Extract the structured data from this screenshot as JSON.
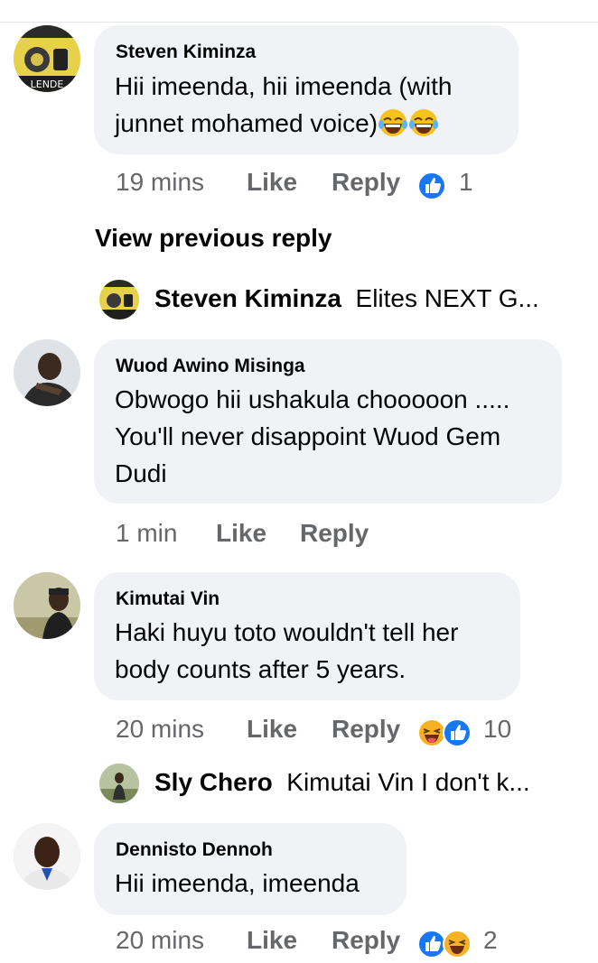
{
  "comments": [
    {
      "author": "Steven Kiminza",
      "text_line1": "Hii imeenda,  hii imeenda (with",
      "text_line2": "junnet mohamed voice)",
      "time": "19 mins",
      "like": "Like",
      "reply": "Reply",
      "reaction_count": "1",
      "avatar_text": "LENDE"
    },
    {
      "author": "Wuod Awino Misinga",
      "text_line1": "Obwogo hii ushakula chooooon .....",
      "text_line2": "You'll never disappoint Wuod Gem",
      "text_line3": "Dudi",
      "time": "1 min",
      "like": "Like",
      "reply": "Reply"
    },
    {
      "author": "Kimutai Vin",
      "text_line1": "Haki huyu toto wouldn't tell her",
      "text_line2": "body counts after 5 years.",
      "time": "20 mins",
      "like": "Like",
      "reply": "Reply",
      "reaction_count": "10"
    },
    {
      "author": "Dennisto Dennoh",
      "text_line1": "Hii imeenda, imeenda",
      "time": "20 mins",
      "like": "Like",
      "reply": "Reply",
      "reaction_count": "2"
    }
  ],
  "view_previous": "View previous reply",
  "replies": [
    {
      "author": "Steven Kiminza",
      "preview": "Elites NEXT G..."
    },
    {
      "author": "Sly Chero",
      "preview": "Kimutai Vin I don't k..."
    }
  ],
  "colors": {
    "bubble": "#f0f2f5",
    "meta": "#65676b",
    "like_blue": "#1877f2",
    "haha": "#f7b125"
  },
  "icons": [
    "like-reaction-icon",
    "haha-reaction-icon",
    "laughing-emoji-icon"
  ]
}
